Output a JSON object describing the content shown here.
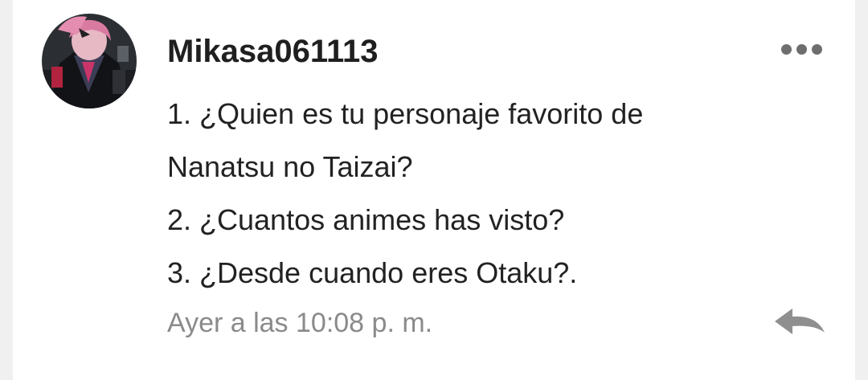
{
  "comment": {
    "username": "Mikasa061113",
    "lines": [
      "1. ¿Quien es tu personaje favorito de",
      "Nanatsu no Taizai?",
      "2. ¿Cuantos animes has visto?",
      "3. ¿Desde cuando eres Otaku?."
    ],
    "timestamp": "Ayer a las 10:08 p. m."
  },
  "icons": {
    "more": "more-options-icon",
    "reply": "reply-icon",
    "avatar": "user-avatar"
  },
  "colors": {
    "card_background": "#ffffff",
    "page_background": "#f0f0f0",
    "username": "#1f1f1f",
    "body": "#222222",
    "timestamp": "#8a8a8a",
    "icon_gray": "#6e6e6e"
  }
}
